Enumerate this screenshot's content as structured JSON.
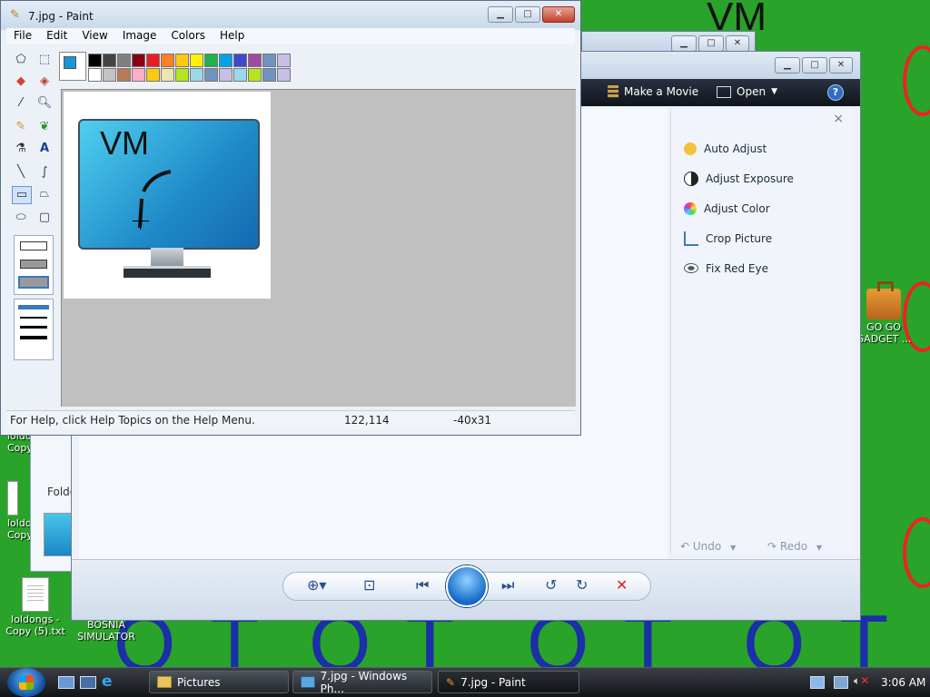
{
  "desktop": {
    "scribble_top": "VM",
    "ot_text": "OT",
    "icons": [
      {
        "label": "loldongs -\nCopy (5).txt"
      },
      {
        "label": "BOSNIA\nSIMULATOR"
      },
      {
        "label": "GO GO\nGADGET ..."
      },
      {
        "label": "loldo\nCopy"
      },
      {
        "label": "loldo\nCopy"
      }
    ]
  },
  "paint": {
    "title": "7.jpg - Paint",
    "menu": [
      "File",
      "Edit",
      "View",
      "Image",
      "Colors",
      "Help"
    ],
    "status": {
      "help": "For Help, click Help Topics on the Help Menu.",
      "coords": "122,114",
      "size": "-40x31"
    },
    "image_scribble": "VM",
    "palette": [
      "#000000",
      "#444444",
      "#7f7f7f",
      "#880015",
      "#ed1c24",
      "#ff7f27",
      "#ffc90e",
      "#fff200",
      "#22b14c",
      "#00a2e8",
      "#3f48cc",
      "#a349a4",
      "#7092be",
      "#c8bfe7",
      "#ffffff",
      "#c3c3c3",
      "#b97a57",
      "#ffaec9",
      "#ffc90e",
      "#efe4b0",
      "#b5e61d",
      "#99d9ea",
      "#7092be",
      "#c8bfe7",
      "#99d9ea",
      "#b5e61d",
      "#7092be",
      "#c8bfe7"
    ]
  },
  "gallery": {
    "toolbar": {
      "make_movie": "Make a Movie",
      "open": "Open",
      "help": "?"
    },
    "fix_panel": [
      {
        "label": "Auto Adjust",
        "color": "#f2c23a"
      },
      {
        "label": "Adjust Exposure",
        "color": "#222222"
      },
      {
        "label": "Adjust Color",
        "color": "#d86bd4"
      },
      {
        "label": "Crop Picture",
        "color": "#3a78c4"
      },
      {
        "label": "Fix Red Eye",
        "color": "#4a5a6a"
      }
    ],
    "undo": "Undo",
    "redo": "Redo",
    "close_panel": "×"
  },
  "folders_win": {
    "label": "Folde"
  },
  "taskbar": {
    "buttons": [
      {
        "label": "Pictures"
      },
      {
        "label": "7.jpg - Windows Ph..."
      },
      {
        "label": "7.jpg - Paint"
      }
    ],
    "clock": "3:06 AM"
  }
}
